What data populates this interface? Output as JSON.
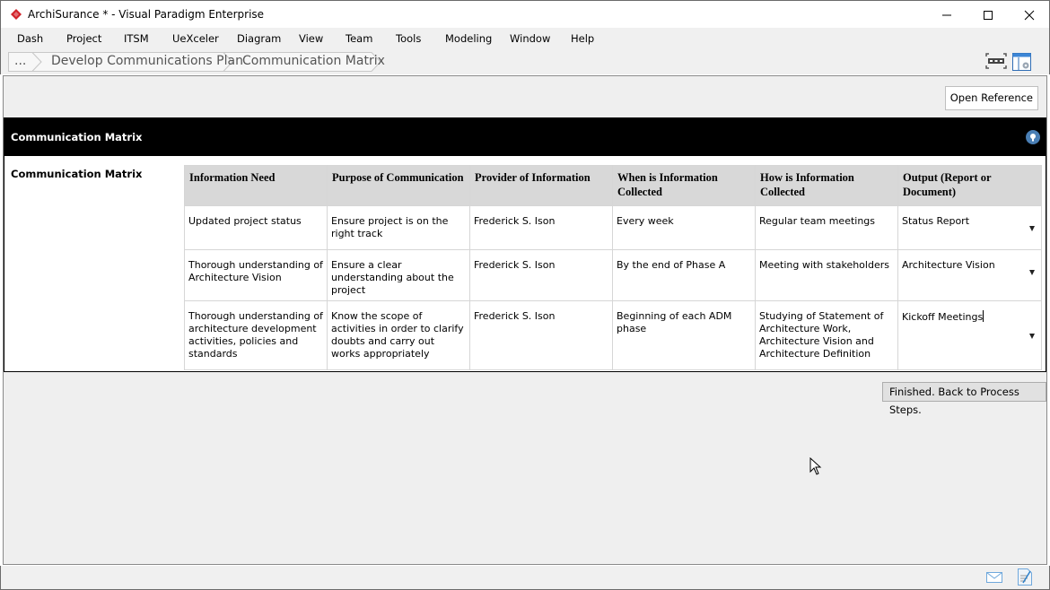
{
  "window": {
    "title": "ArchiSurance * - Visual Paradigm Enterprise",
    "controls": [
      "minimize",
      "maximize",
      "close"
    ]
  },
  "menu": {
    "items": [
      {
        "label": "Dash"
      },
      {
        "label": "Project"
      },
      {
        "label": "ITSM"
      },
      {
        "label": "UeXceler"
      },
      {
        "label": "Diagram"
      },
      {
        "label": "View"
      },
      {
        "label": "Team"
      },
      {
        "label": "Tools"
      },
      {
        "label": "Modeling"
      },
      {
        "label": "Window"
      },
      {
        "label": "Help"
      }
    ]
  },
  "breadcrumb": {
    "items": [
      {
        "label": "..."
      },
      {
        "label": "Develop Communications Plan"
      },
      {
        "label": "Communication Matrix"
      }
    ]
  },
  "toolbar": {
    "open_reference_label": "Open Reference"
  },
  "panel": {
    "header_title": "Communication Matrix",
    "side_label": "Communication Matrix"
  },
  "matrix": {
    "columns": [
      "Information Need",
      "Purpose of Communication",
      "Provider of Information",
      "When is Information Collected",
      "How is Information Collected",
      "Output (Report or Document)"
    ],
    "rows": [
      {
        "information_need": "Updated project status",
        "purpose": "Ensure project is on the right track",
        "provider": "Frederick S. Ison",
        "when": "Every week",
        "how": "Regular team meetings",
        "output": "Status Report"
      },
      {
        "information_need": "Thorough understanding of Architecture Vision",
        "purpose": "Ensure a clear understanding about the project",
        "provider": "Frederick S. Ison",
        "when": "By the end of Phase A",
        "how": "Meeting with stakeholders",
        "output": "Architecture Vision"
      },
      {
        "information_need": "Thorough understanding of architecture development activities, policies and standards",
        "purpose": "Know the scope of activities in order to clarify doubts and carry out works appropriately",
        "provider": "Frederick S. Ison",
        "when": "Beginning of each ADM phase",
        "how": "Studying of Statement of Architecture Work, Architecture Vision and Architecture Definition",
        "output": "Kickoff Meetings"
      }
    ]
  },
  "footer": {
    "finish_label": "Finished. Back to Process Steps."
  },
  "colors": {
    "brand": "#d2232a",
    "panel_header_bg": "#000000",
    "table_header_bg": "#d8d8d8",
    "hint_icon": "#4a7fb5"
  }
}
